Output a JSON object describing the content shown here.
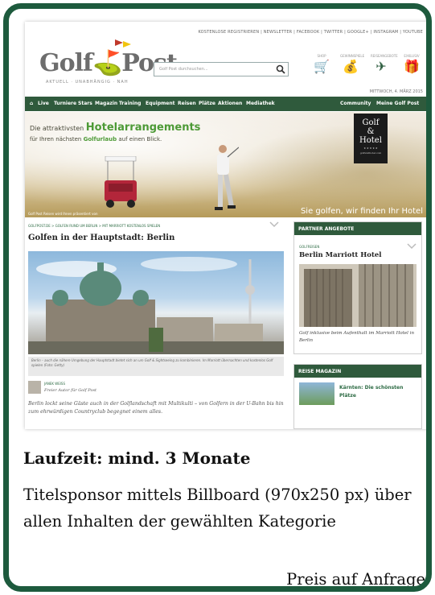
{
  "screenshot": {
    "topbar_links": "KOSTENLOSE REGISTRIEREN | NEWSLETTER | FACEBOOK | TWITTER | GOOGLE+ | INSTAGRAM | YOUTUBE",
    "logo": {
      "word1": "Golf",
      "word2": "Post",
      "tagline": "AKTUELL · UNABHÄNGIG · NAH"
    },
    "search": {
      "placeholder": "Golf Post durchsuchen..."
    },
    "header_icons": [
      {
        "label": "SHOP",
        "icon": "cart-icon"
      },
      {
        "label": "GEWINNSPIELE",
        "icon": "money-bag-icon"
      },
      {
        "label": "REISEANGEBOTE",
        "icon": "plane-icon"
      },
      {
        "label": "EXKLUSIV",
        "icon": "gift-icon"
      }
    ],
    "date": "MITTWOCH, 4. MÄRZ 2015",
    "nav": {
      "live": "Live",
      "turniere": "Turniere",
      "stars": "Stars",
      "magazin": "Magazin",
      "training": "Training",
      "equipment": "Equipment",
      "reisen": "Reisen",
      "plaetze": "Plätze",
      "aktionen": "Aktionen",
      "mediathek": "Mediathek",
      "community": "Community",
      "meine": "Meine Golf Post"
    },
    "banner": {
      "line1_prefix": "Die attraktivsten",
      "line1_highlight": "Hotelarrangements",
      "line2_prefix": "für Ihren nächsten",
      "line2_highlight": "Golfurlaub",
      "line2_suffix": "auf einen Blick.",
      "hotel_logo_1": "Golf",
      "hotel_logo_2": "&",
      "hotel_logo_3": "Hotel",
      "hotel_logo_stars": "★ ★ ★ ★ ★",
      "hotel_logo_url": "golfundhotel.com",
      "slogan": "Sie golfen, wir finden Ihr Hotel",
      "footer": "Golf Post Reisen wird Ihnen präsentiert von"
    },
    "article": {
      "breadcrumb": "GOLFPOST.DE > GOLFEN RUND UM BERLIN > MIT MARRIOTT KOSTENLOS SPIELEN",
      "title": "Golfen in der Hauptstadt: Berlin",
      "caption": "Berlin – auch die nähere Umgebung der Hauptstadt bietet sich an um Golf & Sightseeing zu kombinieren. Im Marriott übernachten und kostenlos Golf spielen (Foto: Getty)",
      "author_name": "JANEK WEISS",
      "author_role": "Freier Autor für Golf Post",
      "teaser": "Berlin lockt seine Gäste auch in der Golflandschaft mit Multikulti – von Golfern in der U-Bahn bis hin zum ehrwürdigen Countryclub begegnet einem alles."
    },
    "partner": {
      "heading": "PARTNER ANGEBOTE",
      "kicker": "GOLFREISEN",
      "title": "Berlin Marriott Hotel",
      "desc": "Golf inklusive beim Aufenthalt im Marriott Hotel in Berlin"
    },
    "reise": {
      "heading": "REISE MAGAZIN",
      "item_title": "Kärnten: Die schönsten Plätze"
    }
  },
  "info": {
    "heading": "Laufzeit: mind. 3 Monate",
    "description": "Titelsponsor mittels Billboard (970x250 px) über allen Inhalten der gewählten Kategorie",
    "price": "Preis auf Anfrage"
  },
  "colors": {
    "frame": "#1d5a3d",
    "nav": "#2f5a3c",
    "banner_green": "#4d9a36"
  }
}
